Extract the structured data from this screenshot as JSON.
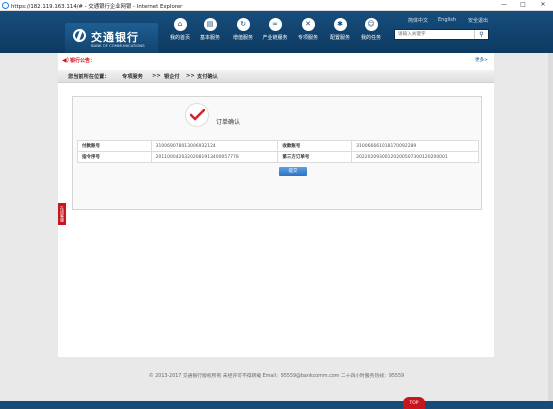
{
  "window": {
    "title": "https://182.119.163.114/# - 交通银行企业网银 - Internet Explorer",
    "min": "—",
    "max": "□",
    "close": "✕"
  },
  "brand": {
    "name_cn": "交通银行",
    "name_en": "BANK OF COMMUNICATIONS"
  },
  "nav": [
    {
      "label": "我的首页",
      "icon": "home-icon",
      "glyph": "⌂"
    },
    {
      "label": "基本服务",
      "icon": "document-icon",
      "glyph": "▤"
    },
    {
      "label": "增值服务",
      "icon": "cycle-icon",
      "glyph": "↻"
    },
    {
      "label": "产业链服务",
      "icon": "link-icon",
      "glyph": "∞"
    },
    {
      "label": "专项服务",
      "icon": "tools-icon",
      "glyph": "✕"
    },
    {
      "label": "配置服务",
      "icon": "gear-icon",
      "glyph": "✱"
    },
    {
      "label": "我的任务",
      "icon": "user-icon",
      "glyph": "☺"
    }
  ],
  "top_links": {
    "cn": "简体中文",
    "en": "English",
    "logout": "安全退出"
  },
  "search": {
    "placeholder": "请输入关键字",
    "icon": "search-icon"
  },
  "notice": {
    "label": "银行公告：",
    "more": "更多>"
  },
  "breadcrumb": {
    "prefix": "您当前所在位置：",
    "level1": "专项服务",
    "sep1": ">>",
    "level2": "银企付",
    "sep2": ">>",
    "level3": "支付确认"
  },
  "order": {
    "title": "订单确认",
    "rows": [
      {
        "k1": "付款账号",
        "v1": "310069078013006932124",
        "k2": "收款账号",
        "v2": "310066661018170092289"
      },
      {
        "k1": "指令序号",
        "v1": "20110004203202081913400057778",
        "k2": "第三方订单号",
        "v2": "20220209300120200507300120200001"
      }
    ],
    "button": "提交"
  },
  "side_tab": "在线客服",
  "footer": "© 2013-2017 交通银行版权所有 未经许可不得转载 Email：95559@bankcomm.com 二十四小时服务热线：95559",
  "top_button": "TOP",
  "colors": {
    "header": "#174d7c",
    "accent_red": "#c8161d",
    "button_blue": "#2d73c2"
  }
}
